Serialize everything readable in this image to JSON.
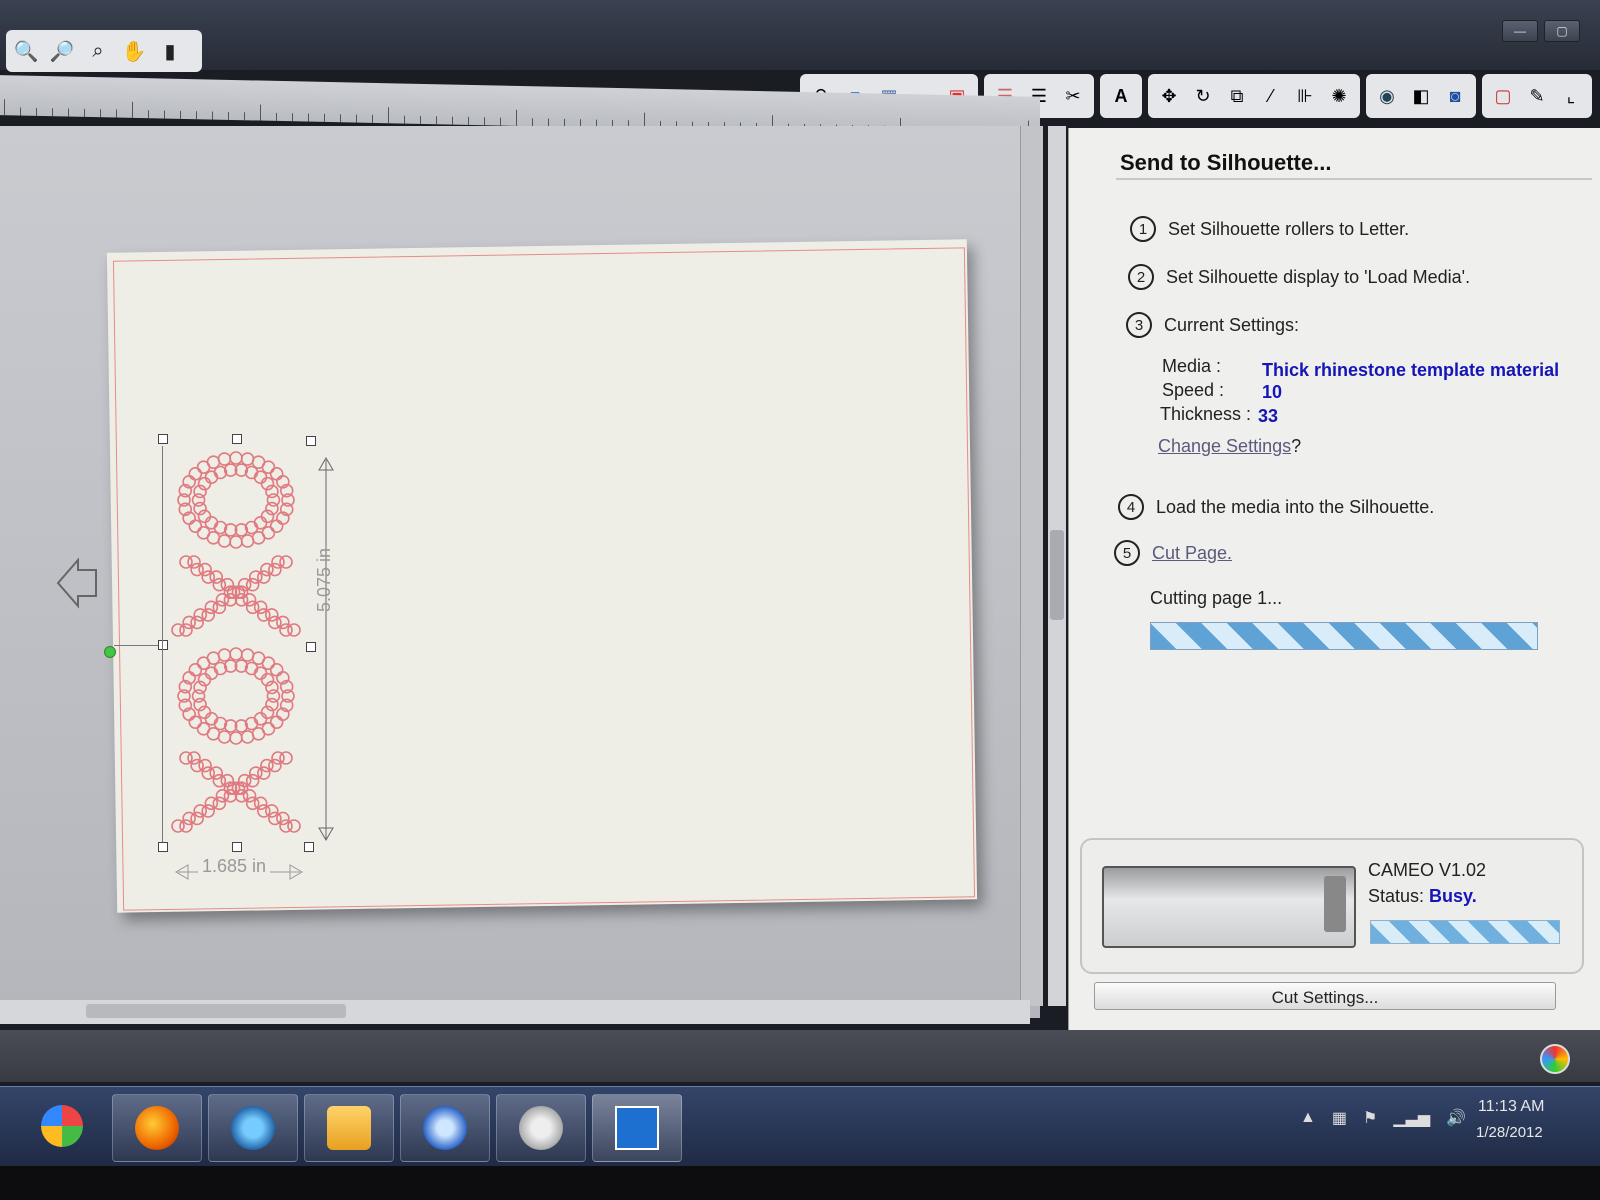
{
  "window": {
    "controls": [
      "—",
      "▢"
    ]
  },
  "zoom_tools": {
    "icons": [
      "zoom-in-icon",
      "zoom-out-icon",
      "zoom-select-icon",
      "pan-icon",
      "fit-page-icon"
    ]
  },
  "canvas": {
    "height_label": "5.075 in",
    "width_label": "1.685 in"
  },
  "panel": {
    "title": "Send to Silhouette...",
    "step1": "Set Silhouette rollers to Letter.",
    "step2": "Set Silhouette display to 'Load Media'.",
    "step3": "Current Settings:",
    "media_label": "Media :",
    "media_value": "Thick rhinestone template material",
    "speed_label": "Speed :",
    "speed_value": "10",
    "thickness_label": "Thickness :",
    "thickness_value": "33",
    "change_settings": "Change Settings",
    "change_settings_q": "?",
    "step4": "Load the media into the Silhouette.",
    "step5": "Cut Page.",
    "cutting_status": "Cutting page 1...",
    "cutting_progress": 1.0,
    "numbers": [
      "1",
      "2",
      "3",
      "4",
      "5"
    ]
  },
  "device": {
    "name": "CAMEO V1.02",
    "status_label": "Status:",
    "status_value": "Busy."
  },
  "cut_settings_button": "Cut Settings...",
  "tray": {
    "time": "11:13 AM",
    "date": "1/28/2012"
  },
  "colors": {
    "accent_blue": "#1515b8",
    "cut_line": "#e98a8a",
    "rhinestone": "#e07a80"
  }
}
